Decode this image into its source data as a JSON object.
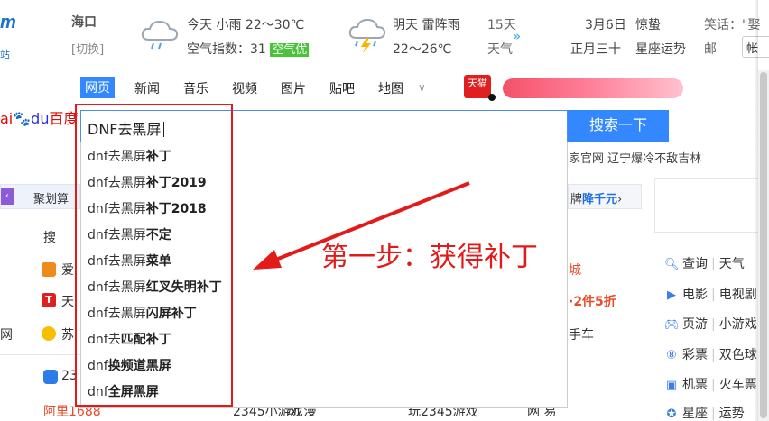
{
  "header": {
    "logo_fragment": "m",
    "logo_sub": "站",
    "city": "海口",
    "switch_label": "[切换]",
    "today": {
      "label": "今天",
      "weather": "小雨",
      "temp": "22～30℃"
    },
    "aqi": {
      "label": "空气指数：31",
      "badge": "空气优",
      "badge_color": "#49c43a"
    },
    "tomorrow": {
      "label": "明天",
      "weather": "雷阵雨",
      "temp": "22～26℃"
    },
    "forecast": {
      "line1": "15天",
      "line2": "天气",
      "more": "»"
    },
    "date": {
      "line1": "3月6日",
      "line2": "正月三十"
    },
    "solar_term": {
      "line1": "惊蛰",
      "line2": "星座运势"
    },
    "joke": {
      "line1": "笑话：\"娶",
      "line2": "邮"
    },
    "account_button": "帐"
  },
  "nav": {
    "items": [
      "网页",
      "新闻",
      "音乐",
      "视频",
      "图片",
      "贴吧",
      "地图"
    ],
    "active_index": 0,
    "more_icon": "chevron-down-icon",
    "tmall_badge": "天猫",
    "accent": "#3388ff"
  },
  "search": {
    "logo_text": "百度",
    "value": "DNF去黑屏",
    "button_label": "搜索一下",
    "suggestions": [
      {
        "prefix": "dnf去黑屏",
        "suffix": "补丁"
      },
      {
        "prefix": "dnf去黑屏",
        "suffix": "补丁2019"
      },
      {
        "prefix": "dnf去黑屏",
        "suffix": "补丁2018"
      },
      {
        "prefix": "dnf去黑屏",
        "suffix": "不定"
      },
      {
        "prefix": "dnf去黑屏",
        "suffix": "菜单"
      },
      {
        "prefix": "dnf去黑屏",
        "suffix": "红叉失明补丁"
      },
      {
        "prefix": "dnf去黑屏",
        "suffix": "闪屏补丁"
      },
      {
        "prefix": "dnf去",
        "suffix": "匹配补丁"
      },
      {
        "prefix": "dnf",
        "suffix": "换频道黑屏"
      },
      {
        "prefix": "dnf",
        "suffix": "全屏黑屏"
      }
    ],
    "hot_after": "家官网 辽宁爆冷不敌吉林"
  },
  "left": {
    "banner_label": "聚划算",
    "items": [
      "搜",
      "爱",
      "天",
      "苏"
    ],
    "edge_text": "网",
    "bottom_count": "23",
    "bottom_link": "阿里1688"
  },
  "middle": {
    "banner": {
      "left": "牌",
      "highlight": "降千元",
      "arrow": "›"
    },
    "promo1": "城",
    "promo2": "·2件5折",
    "promo3": "手车",
    "bottom_row": [
      "2345小游戏",
      "动  漫",
      "玩2345游戏",
      "网  易"
    ]
  },
  "right": {
    "services": [
      {
        "icon": "search-icon",
        "label": "查询",
        "other": "天气"
      },
      {
        "icon": "video-icon",
        "label": "电影",
        "other": "电视剧"
      },
      {
        "icon": "gamepad-icon",
        "label": "页游",
        "other": "小游戏"
      },
      {
        "icon": "lottery-icon",
        "label": "彩票",
        "other": "双色球"
      },
      {
        "icon": "ticket-icon",
        "label": "机票",
        "other": "火车票"
      },
      {
        "icon": "star-icon",
        "label": "星座",
        "other": "运势"
      }
    ]
  },
  "annotation": {
    "text": "第一步：获得补丁",
    "color": "#e21a1a"
  }
}
